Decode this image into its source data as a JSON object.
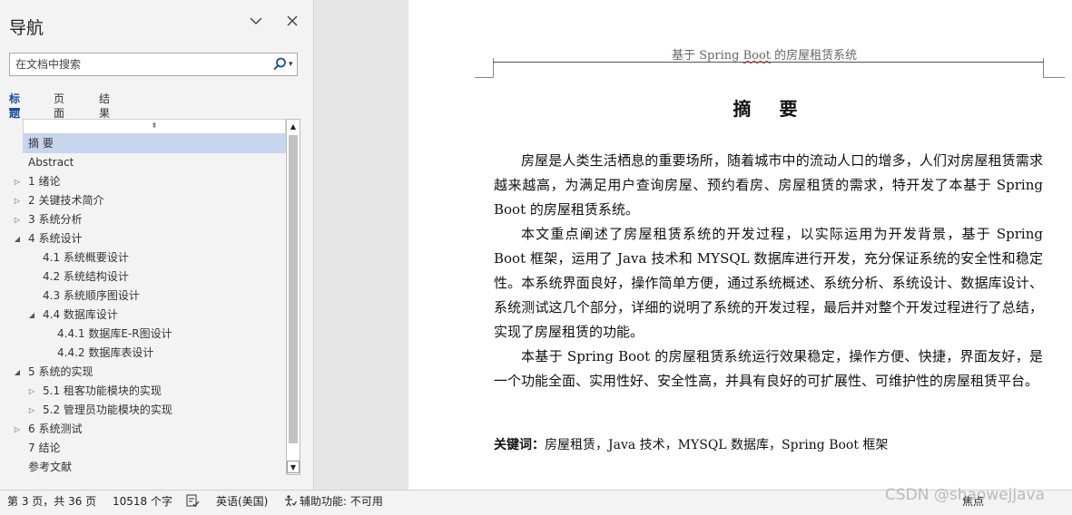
{
  "nav": {
    "title": "导航",
    "search_placeholder": "在文档中搜索",
    "tabs": [
      "标题",
      "页面",
      "结果"
    ],
    "items": [
      {
        "label": "摘  要",
        "level": 0,
        "toggle": "",
        "selected": true
      },
      {
        "label": "Abstract",
        "level": 0,
        "toggle": "",
        "selected": false
      },
      {
        "label": "1 绪论",
        "level": 0,
        "toggle": "collapsed",
        "selected": false
      },
      {
        "label": "2 关键技术简介",
        "level": 0,
        "toggle": "collapsed",
        "selected": false
      },
      {
        "label": "3 系统分析",
        "level": 0,
        "toggle": "collapsed",
        "selected": false
      },
      {
        "label": "4 系统设计",
        "level": 0,
        "toggle": "expanded",
        "selected": false
      },
      {
        "label": "4.1 系统概要设计",
        "level": 1,
        "toggle": "",
        "selected": false
      },
      {
        "label": "4.2 系统结构设计",
        "level": 1,
        "toggle": "",
        "selected": false
      },
      {
        "label": "4.3 系统顺序图设计",
        "level": 1,
        "toggle": "",
        "selected": false
      },
      {
        "label": "4.4 数据库设计",
        "level": 1,
        "toggle": "expanded",
        "selected": false
      },
      {
        "label": "4.4.1 数据库E-R图设计",
        "level": 2,
        "toggle": "",
        "selected": false
      },
      {
        "label": "4.4.2 数据库表设计",
        "level": 2,
        "toggle": "",
        "selected": false
      },
      {
        "label": "5 系统的实现",
        "level": 0,
        "toggle": "expanded",
        "selected": false
      },
      {
        "label": "5.1 租客功能模块的实现",
        "level": 1,
        "toggle": "collapsed",
        "selected": false
      },
      {
        "label": "5.2 管理员功能模块的实现",
        "level": 1,
        "toggle": "collapsed",
        "selected": false
      },
      {
        "label": "6 系统测试",
        "level": 0,
        "toggle": "collapsed",
        "selected": false
      },
      {
        "label": "7 结论",
        "level": 0,
        "toggle": "",
        "selected": false
      },
      {
        "label": "参考文献",
        "level": 0,
        "toggle": "",
        "selected": false
      }
    ]
  },
  "document": {
    "header_prefix": "基于 Spring ",
    "header_squiggle": "Boot",
    "header_suffix": " 的房屋租赁系统",
    "title": "摘 要",
    "paragraphs": [
      "房屋是人类生活栖息的重要场所，随着城市中的流动人口的增多，人们对房屋租赁需求越来越高，为满足用户查询房屋、预约看房、房屋租赁的需求，特开发了本基于 Spring Boot 的房屋租赁系统。",
      "本文重点阐述了房屋租赁系统的开发过程，以实际运用为开发背景，基于 Spring Boot 框架，运用了 Java 技术和 MYSQL 数据库进行开发，充分保证系统的安全性和稳定性。本系统界面良好，操作简单方便，通过系统概述、系统分析、系统设计、数据库设计、系统测试这几个部分，详细的说明了系统的开发过程，最后并对整个开发过程进行了总结，实现了房屋租赁的功能。",
      "本基于 Spring Boot 的房屋租赁系统运行效果稳定，操作方便、快捷，界面友好，是一个功能全面、实用性好、安全性高，并具有良好的可扩展性、可维护性的房屋租赁平台。"
    ],
    "keywords_label": "关键词：",
    "keywords_text": "房屋租赁，Java 技术，MYSQL 数据库，Spring Boot 框架"
  },
  "statusbar": {
    "page": "第 3 页，共 36 页",
    "words": "10518 个字",
    "language": "英语(美国)",
    "accessibility": "辅助功能: 不可用",
    "right_label": "焦点"
  },
  "watermark": "CSDN @shaowejjava"
}
